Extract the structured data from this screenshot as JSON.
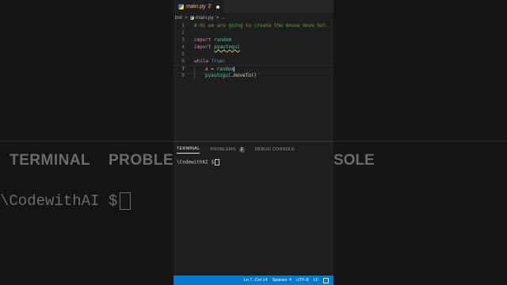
{
  "background": {
    "tabs": [
      "TERMINAL",
      "PROBLEM"
    ],
    "tab_right_fragment": "SOLE",
    "prompt": "\\CodewithAI $"
  },
  "editor": {
    "tab": {
      "filename": "main.py",
      "problems": "2"
    },
    "breadcrumb": [
      "bot",
      ">",
      "main.py",
      ">",
      "..."
    ],
    "lines": [
      {
        "num": "1",
        "comment": "# Hi we are going to create the mouse move bot."
      },
      {
        "num": "2"
      },
      {
        "num": "3",
        "kw": "import",
        "name": "random"
      },
      {
        "num": "4",
        "kw": "import",
        "name": "pyautogui"
      },
      {
        "num": "5"
      },
      {
        "num": "6",
        "kw": "while",
        "value": "True",
        "punct": ":"
      },
      {
        "num": "7",
        "var": "x",
        "op": " = ",
        "name": "random"
      },
      {
        "num": "8",
        "obj": "pyautogui",
        "method": ".moveTo()"
      }
    ]
  },
  "panel": {
    "tabs": {
      "terminal": "TERMINAL",
      "problems": "PROBLEMS",
      "problems_count": "2",
      "debug": "DEBUG CONSOLE"
    },
    "prompt": "\\CodewithAI $"
  },
  "statusbar": {
    "position": "Ln 7, Col 14",
    "spaces": "Spaces: 4",
    "encoding": "UTF-8",
    "eol": "LF"
  }
}
